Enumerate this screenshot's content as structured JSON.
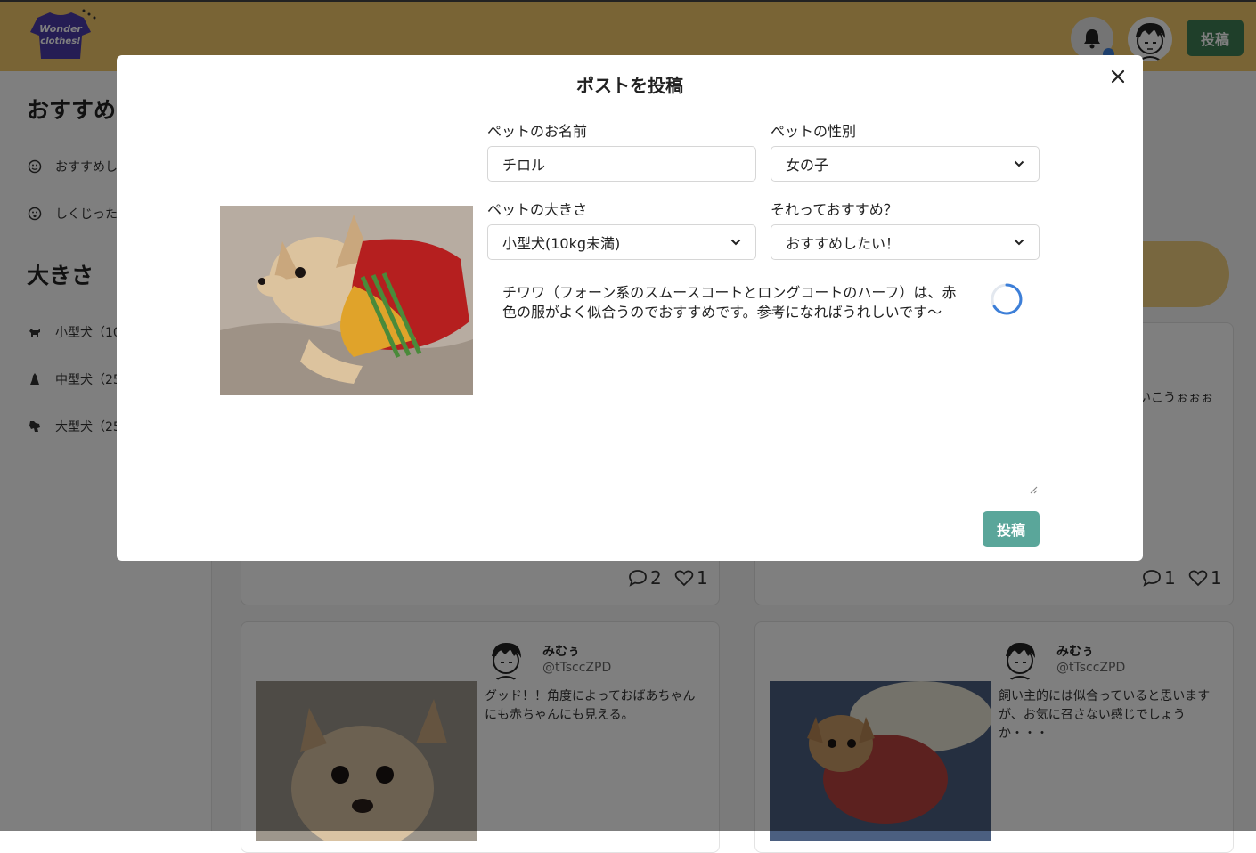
{
  "header": {
    "logo_text": "Wonder clothes!",
    "post_button": "投稿"
  },
  "sidebar": {
    "recommend_heading": "おすすめ",
    "recommend_items": [
      {
        "label": "おすすめし",
        "icon": "smile-face-icon"
      },
      {
        "label": "しくじった",
        "icon": "surprised-face-icon"
      }
    ],
    "size_heading": "大きさ",
    "size_items": [
      {
        "label": "小型犬（10",
        "icon": "small-dog-icon"
      },
      {
        "label": "中型犬（25",
        "icon": "medium-dog-icon"
      },
      {
        "label": "大型犬（25",
        "icon": "large-dog-icon"
      }
    ]
  },
  "feed": {
    "top_cards": [
      {
        "comments": "2",
        "likes": "1"
      },
      {
        "comments": "1",
        "likes": "1",
        "text_fragment": "いこうぉぉぉ"
      }
    ],
    "bottom_cards": [
      {
        "name": "みむぅ",
        "handle": "@tTsccZPD",
        "text": "グッド！！角度によっておばあちゃんにも赤ちゃんにも見える。"
      },
      {
        "name": "みむぅ",
        "handle": "@tTsccZPD",
        "text": "飼い主的には似合っていると思いますが、お気に召さない感じでしょうか・・・"
      }
    ]
  },
  "modal": {
    "title": "ポストを投稿",
    "pet_name_label": "ペットのお名前",
    "pet_name_value": "チロル",
    "pet_gender_label": "ペットの性別",
    "pet_gender_value": "女の子",
    "pet_size_label": "ペットの大きさ",
    "pet_size_value": "小型犬(10kg未満)",
    "recommend_label": "それっておすすめ？",
    "recommend_value": "おすすめしたい！",
    "description": "チワワ（フォーン系のスムースコートとロングコートのハーフ）は、赤色の服がよく似合うのでおすすめです。参考になればうれしいです〜",
    "submit_label": "投稿"
  },
  "colors": {
    "header_bg": "#f3c96b",
    "header_post_button": "#3f7f55",
    "submit_button": "#5aa69a",
    "spinner": "#3d7fd8",
    "notification_dot": "#3d7fd8"
  }
}
